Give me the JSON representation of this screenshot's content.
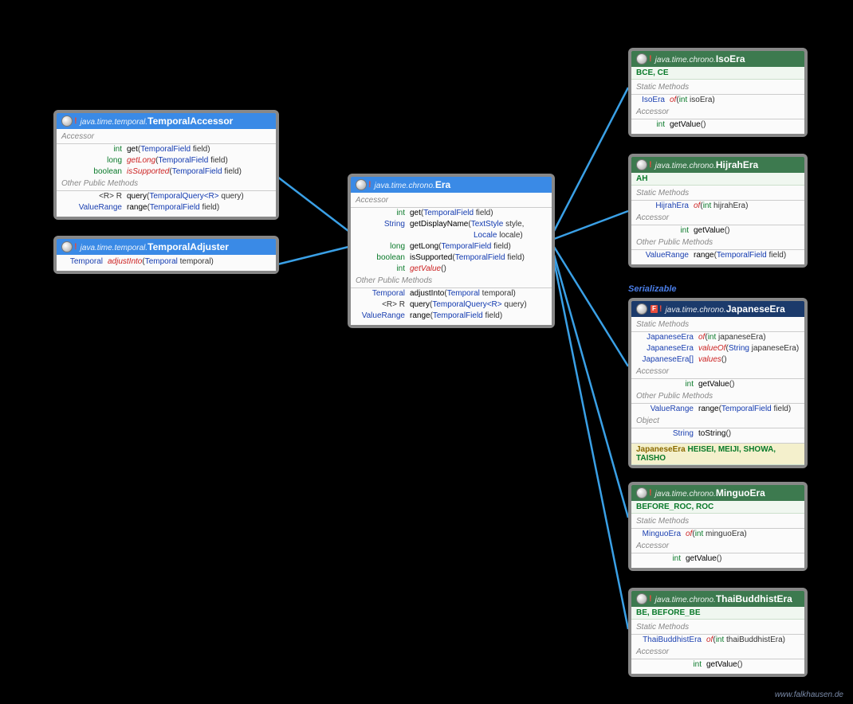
{
  "footer": "www.falkhausen.de",
  "serializable_label": "Serializable",
  "boxes": {
    "temporalAccessor": {
      "pkg": "java.time.temporal.",
      "cls": "TemporalAccessor",
      "sect_accessor": "Accessor",
      "sect_other": "Other Public Methods",
      "m1_ret": "int",
      "m1_name": "get",
      "m1_args_t": "TemporalField",
      "m1_args_n": "field",
      "m2_ret": "long",
      "m2_name": "getLong",
      "m2_args_t": "TemporalField",
      "m2_args_n": "field",
      "m3_ret": "boolean",
      "m3_name": "isSupported",
      "m3_args_t": "TemporalField",
      "m3_args_n": "field",
      "m4_ret": "<R> R",
      "m4_name": "query",
      "m4_args_t": "TemporalQuery<R>",
      "m4_args_n": "query",
      "m5_ret": "ValueRange",
      "m5_name": "range",
      "m5_args_t": "TemporalField",
      "m5_args_n": "field"
    },
    "temporalAdjuster": {
      "pkg": "java.time.temporal.",
      "cls": "TemporalAdjuster",
      "m1_ret": "Temporal",
      "m1_name": "adjustInto",
      "m1_args_t": "Temporal",
      "m1_args_n": "temporal"
    },
    "era": {
      "pkg": "java.time.chrono.",
      "cls": "Era",
      "sect_accessor": "Accessor",
      "sect_other": "Other Public Methods",
      "m1_ret": "int",
      "m1_name": "get",
      "m1_args_t": "TemporalField",
      "m1_args_n": "field",
      "m2_ret": "String",
      "m2_name": "getDisplayName",
      "m2_args_t1": "TextStyle",
      "m2_args_n1": "style,",
      "m2b_args_t": "Locale",
      "m2b_args_n": "locale",
      "m3_ret": "long",
      "m3_name": "getLong",
      "m3_args_t": "TemporalField",
      "m3_args_n": "field",
      "m4_ret": "boolean",
      "m4_name": "isSupported",
      "m4_args_t": "TemporalField",
      "m4_args_n": "field",
      "m5_ret": "int",
      "m5_name": "getValue",
      "m6_ret": "Temporal",
      "m6_name": "adjustInto",
      "m6_args_t": "Temporal",
      "m6_args_n": "temporal",
      "m7_ret": "<R> R",
      "m7_name": "query",
      "m7_args_t": "TemporalQuery<R>",
      "m7_args_n": "query",
      "m8_ret": "ValueRange",
      "m8_name": "range",
      "m8_args_t": "TemporalField",
      "m8_args_n": "field"
    },
    "isoEra": {
      "pkg": "java.time.chrono.",
      "cls": "IsoEra",
      "consts": "BCE, CE",
      "sect_static": "Static Methods",
      "sect_accessor": "Accessor",
      "m1_ret": "IsoEra",
      "m1_name": "of",
      "m1_args_t": "int",
      "m1_args_n": "isoEra",
      "m2_ret": "int",
      "m2_name": "getValue"
    },
    "hijrahEra": {
      "pkg": "java.time.chrono.",
      "cls": "HijrahEra",
      "consts": "AH",
      "sect_static": "Static Methods",
      "sect_accessor": "Accessor",
      "sect_other": "Other Public Methods",
      "m1_ret": "HijrahEra",
      "m1_name": "of",
      "m1_args_t": "int",
      "m1_args_n": "hijrahEra",
      "m2_ret": "int",
      "m2_name": "getValue",
      "m3_ret": "ValueRange",
      "m3_name": "range",
      "m3_args_t": "TemporalField",
      "m3_args_n": "field"
    },
    "japaneseEra": {
      "pkg": "java.time.chrono.",
      "cls": "JapaneseEra",
      "sect_static": "Static Methods",
      "sect_accessor": "Accessor",
      "sect_other": "Other Public Methods",
      "sect_object": "Object",
      "m1_ret": "JapaneseEra",
      "m1_name": "of",
      "m1_args_t": "int",
      "m1_args_n": "japaneseEra",
      "m2_ret": "JapaneseEra",
      "m2_name": "valueOf",
      "m2_args_t": "String",
      "m2_args_n": "japaneseEra",
      "m3_ret": "JapaneseEra[]",
      "m3_name": "values",
      "m4_ret": "int",
      "m4_name": "getValue",
      "m5_ret": "ValueRange",
      "m5_name": "range",
      "m5_args_t": "TemporalField",
      "m5_args_n": "field",
      "m6_ret": "String",
      "m6_name": "toString",
      "consts_pre": "JapaneseEra",
      "consts": "HEISEI, MEIJI, SHOWA, TAISHO"
    },
    "minguoEra": {
      "pkg": "java.time.chrono.",
      "cls": "MinguoEra",
      "consts": "BEFORE_ROC, ROC",
      "sect_static": "Static Methods",
      "sect_accessor": "Accessor",
      "m1_ret": "MinguoEra",
      "m1_name": "of",
      "m1_args_t": "int",
      "m1_args_n": "minguoEra",
      "m2_ret": "int",
      "m2_name": "getValue"
    },
    "thaiBuddhistEra": {
      "pkg": "java.time.chrono.",
      "cls": "ThaiBuddhistEra",
      "consts": "BE, BEFORE_BE",
      "sect_static": "Static Methods",
      "sect_accessor": "Accessor",
      "m1_ret": "ThaiBuddhistEra",
      "m1_name": "of",
      "m1_args_t": "int",
      "m1_args_n": "thaiBuddhistEra",
      "m2_ret": "int",
      "m2_name": "getValue"
    }
  }
}
